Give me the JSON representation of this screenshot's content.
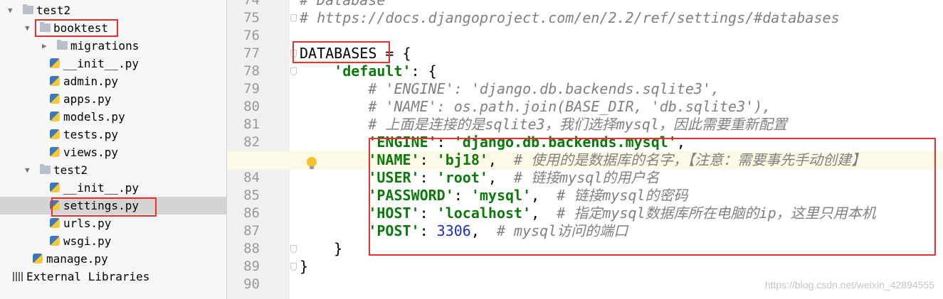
{
  "project_tree": {
    "items": [
      {
        "label": "test2",
        "kind": "folder",
        "expanded": true,
        "selected": false
      },
      {
        "label": "booktest",
        "kind": "folder",
        "expanded": true,
        "selected": false
      },
      {
        "label": "migrations",
        "kind": "folder",
        "expanded": false,
        "selected": false
      },
      {
        "label": "__init__.py",
        "kind": "python-file",
        "selected": false
      },
      {
        "label": "admin.py",
        "kind": "python-file",
        "selected": false
      },
      {
        "label": "apps.py",
        "kind": "python-file",
        "selected": false
      },
      {
        "label": "models.py",
        "kind": "python-file",
        "selected": false
      },
      {
        "label": "tests.py",
        "kind": "python-file",
        "selected": false
      },
      {
        "label": "views.py",
        "kind": "python-file",
        "selected": false
      },
      {
        "label": "test2",
        "kind": "folder",
        "expanded": true,
        "selected": false
      },
      {
        "label": "__init__.py",
        "kind": "python-file",
        "selected": false
      },
      {
        "label": "settings.py",
        "kind": "python-file",
        "selected": true
      },
      {
        "label": "urls.py",
        "kind": "python-file",
        "selected": false
      },
      {
        "label": "wsgi.py",
        "kind": "python-file",
        "selected": false
      },
      {
        "label": "manage.py",
        "kind": "python-file",
        "selected": false
      },
      {
        "label": "External Libraries",
        "kind": "library",
        "selected": false
      }
    ]
  },
  "editor": {
    "current_line": "83",
    "lines": [
      {
        "num": "74",
        "tokens": [
          {
            "t": "# Database",
            "c": "com"
          }
        ]
      },
      {
        "num": "75",
        "tokens": [
          {
            "t": "# https://docs.djangoproject.com/en/2.2/ref/settings/#databases",
            "c": "com"
          }
        ]
      },
      {
        "num": "76",
        "tokens": []
      },
      {
        "num": "77",
        "tokens": [
          {
            "t": "DATABASES",
            "c": "id"
          },
          {
            "t": " = {",
            "c": "pun"
          }
        ]
      },
      {
        "num": "78",
        "tokens": [
          {
            "t": "    ",
            "c": "pun"
          },
          {
            "t": "'default'",
            "c": "str"
          },
          {
            "t": ": {",
            "c": "pun"
          }
        ]
      },
      {
        "num": "79",
        "tokens": [
          {
            "t": "        # 'ENGINE': 'django.db.backends.sqlite3',",
            "c": "com"
          }
        ]
      },
      {
        "num": "80",
        "tokens": [
          {
            "t": "        # 'NAME': os.path.join(BASE_DIR, 'db.sqlite3'),",
            "c": "com"
          }
        ]
      },
      {
        "num": "81",
        "tokens": [
          {
            "t": "        # 上面是连接的是sqlite3，我们选择mysql，因此需要重新配置",
            "c": "com"
          }
        ]
      },
      {
        "num": "82",
        "tokens": [
          {
            "t": "        ",
            "c": "pun"
          },
          {
            "t": "'ENGINE'",
            "c": "str"
          },
          {
            "t": ": ",
            "c": "pun"
          },
          {
            "t": "'django.db.backends.mysql'",
            "c": "str"
          },
          {
            "t": ",",
            "c": "pun"
          }
        ]
      },
      {
        "num": "83",
        "tokens": [
          {
            "t": "        ",
            "c": "pun"
          },
          {
            "t": "'NAME'",
            "c": "str"
          },
          {
            "t": ": ",
            "c": "pun"
          },
          {
            "t": "'bj18'",
            "c": "str"
          },
          {
            "t": ",  ",
            "c": "pun"
          },
          {
            "t": "# 使用的是数据库的名字，【注意：需要事先手动创建】",
            "c": "com"
          }
        ]
      },
      {
        "num": "84",
        "tokens": [
          {
            "t": "        ",
            "c": "pun"
          },
          {
            "t": "'USER'",
            "c": "str"
          },
          {
            "t": ": ",
            "c": "pun"
          },
          {
            "t": "'root'",
            "c": "str"
          },
          {
            "t": ",  ",
            "c": "pun"
          },
          {
            "t": "# 链接mysql的用户名",
            "c": "com"
          }
        ]
      },
      {
        "num": "85",
        "tokens": [
          {
            "t": "        ",
            "c": "pun"
          },
          {
            "t": "'PASSWORD'",
            "c": "str"
          },
          {
            "t": ": ",
            "c": "pun"
          },
          {
            "t": "'mysql'",
            "c": "str"
          },
          {
            "t": ",  ",
            "c": "pun"
          },
          {
            "t": "# 链接mysql的密码",
            "c": "com"
          }
        ]
      },
      {
        "num": "86",
        "tokens": [
          {
            "t": "        ",
            "c": "pun"
          },
          {
            "t": "'HOST'",
            "c": "str"
          },
          {
            "t": ": ",
            "c": "pun"
          },
          {
            "t": "'localhost'",
            "c": "str"
          },
          {
            "t": ",  ",
            "c": "pun"
          },
          {
            "t": "# 指定mysql数据库所在电脑的ip，这里只用本机",
            "c": "com"
          }
        ]
      },
      {
        "num": "87",
        "tokens": [
          {
            "t": "        ",
            "c": "pun"
          },
          {
            "t": "'POST'",
            "c": "str"
          },
          {
            "t": ": ",
            "c": "pun"
          },
          {
            "t": "3306",
            "c": "num"
          },
          {
            "t": ",  ",
            "c": "pun"
          },
          {
            "t": "# mysql访问的端口",
            "c": "com"
          }
        ]
      },
      {
        "num": "88",
        "tokens": [
          {
            "t": "    }",
            "c": "pun"
          }
        ]
      },
      {
        "num": "89",
        "tokens": [
          {
            "t": "}",
            "c": "pun"
          }
        ]
      },
      {
        "num": "90",
        "tokens": []
      }
    ]
  },
  "watermark": "https://blog.csdn.net/weixin_42894555",
  "colors": {
    "highlight_box": "#e8302c",
    "string": "#0b7a0b",
    "comment": "#808080",
    "number": "#1b2ed0",
    "current_line_bg": "#fcfae6"
  }
}
